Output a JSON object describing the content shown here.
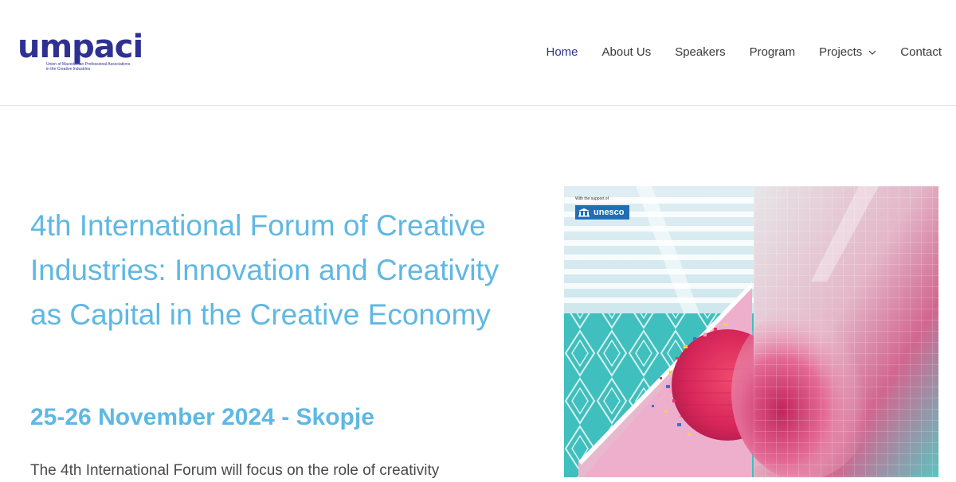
{
  "logo": {
    "word": "umpaci",
    "sub_lines": [
      "Union of Macedonian Professional Associations",
      "in the Creative Industries"
    ]
  },
  "nav": {
    "items": [
      {
        "label": "Home",
        "active": true
      },
      {
        "label": "About Us"
      },
      {
        "label": "Speakers"
      },
      {
        "label": "Program"
      },
      {
        "label": "Projects",
        "has_dropdown": true
      },
      {
        "label": "Contact"
      }
    ]
  },
  "hero": {
    "title": "4th International Forum of Creative Industries: Innovation and Creativity as Capital in the Creative Economy",
    "date": "25-26 November 2024 - Skopje",
    "text": "The 4th International Forum will focus on the role of creativity"
  },
  "poster": {
    "support_text": "With the support of",
    "unesco_label": "unesco"
  },
  "colors": {
    "brand": "#2e3192",
    "accent": "#5fb8e3"
  }
}
